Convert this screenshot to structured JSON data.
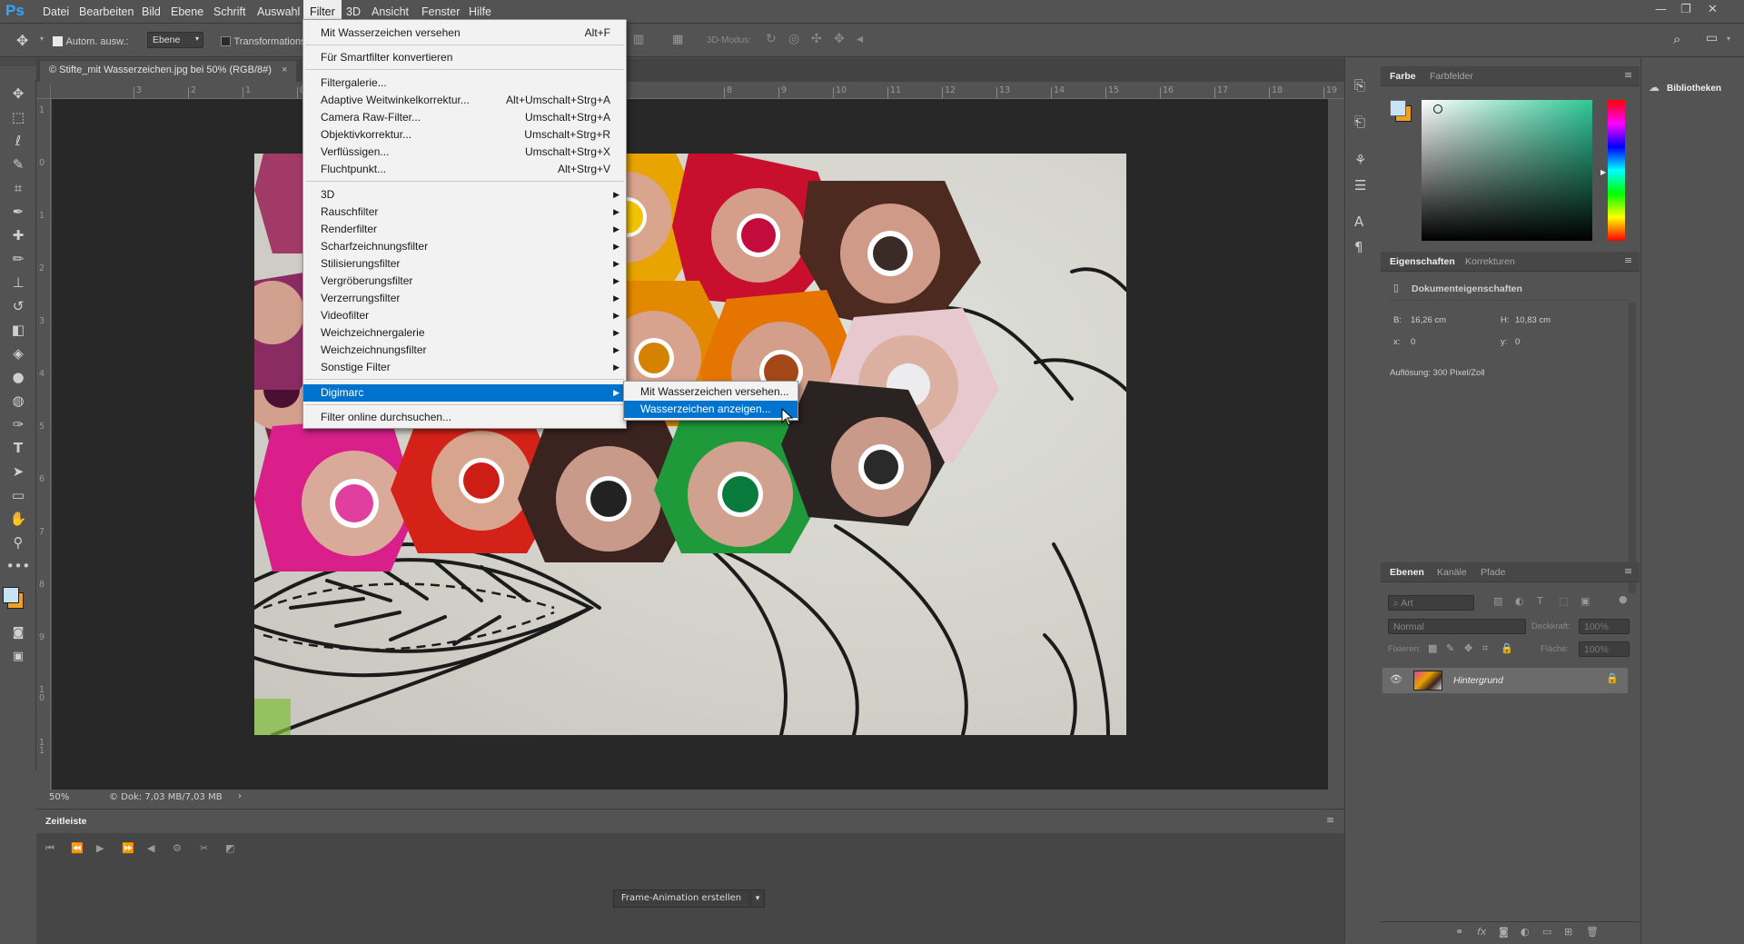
{
  "app": {
    "logo": "Ps"
  },
  "menubar": {
    "items": [
      "Datei",
      "Bearbeiten",
      "Bild",
      "Ebene",
      "Schrift",
      "Auswahl",
      "Filter",
      "3D",
      "Ansicht",
      "Fenster",
      "Hilfe"
    ],
    "active": "Filter"
  },
  "window_controls": {
    "minimize": "—",
    "restore": "❐",
    "close": "✕"
  },
  "options": {
    "auto_select_label": "Autom. ausw.:",
    "auto_select_value": "Ebene",
    "transform_label": "Transformationss",
    "mode_3d_label": "3D-Modus:"
  },
  "document": {
    "tab_title": "© Stifte_mit Wasserzeichen.jpg bei 50% (RGB/8#)",
    "tab_close": "×",
    "zoom": "50%",
    "doc_info": "© Dok: 7,03 MB/7,03 MB",
    "status_arrow": "›"
  },
  "ruler_h": [
    "3",
    "2",
    "1",
    "0",
    "8",
    "9",
    "10",
    "11",
    "12",
    "13",
    "14",
    "15",
    "16",
    "17",
    "18",
    "19"
  ],
  "ruler_v": [
    "1",
    "0",
    "1",
    "2",
    "3",
    "4",
    "5",
    "6",
    "7",
    "8",
    "9",
    "1 0",
    "1 1"
  ],
  "filter_menu": {
    "items": [
      {
        "label": "Mit Wasserzeichen versehen",
        "shortcut": "Alt+F"
      },
      {
        "label": "Für Smartfilter konvertieren",
        "shortcut": ""
      },
      {
        "label": "Filtergalerie...",
        "shortcut": ""
      },
      {
        "label": "Adaptive Weitwinkelkorrektur...",
        "shortcut": "Alt+Umschalt+Strg+A"
      },
      {
        "label": "Camera Raw-Filter...",
        "shortcut": "Umschalt+Strg+A"
      },
      {
        "label": "Objektivkorrektur...",
        "shortcut": "Umschalt+Strg+R"
      },
      {
        "label": "Verflüssigen...",
        "shortcut": "Umschalt+Strg+X"
      },
      {
        "label": "Fluchtpunkt...",
        "shortcut": "Alt+Strg+V"
      },
      {
        "label": "3D",
        "shortcut": ""
      },
      {
        "label": "Rauschfilter",
        "shortcut": ""
      },
      {
        "label": "Renderfilter",
        "shortcut": ""
      },
      {
        "label": "Scharfzeichnungsfilter",
        "shortcut": ""
      },
      {
        "label": "Stilisierungsfilter",
        "shortcut": ""
      },
      {
        "label": "Vergröberungsfilter",
        "shortcut": ""
      },
      {
        "label": "Verzerrungsfilter",
        "shortcut": ""
      },
      {
        "label": "Videofilter",
        "shortcut": ""
      },
      {
        "label": "Weichzeichnergalerie",
        "shortcut": ""
      },
      {
        "label": "Weichzeichnungsfilter",
        "shortcut": ""
      },
      {
        "label": "Sonstige Filter",
        "shortcut": ""
      },
      {
        "label": "Digimarc",
        "shortcut": ""
      },
      {
        "label": "Filter online durchsuchen...",
        "shortcut": ""
      }
    ],
    "submenu_arrow": "▶"
  },
  "digimarc_submenu": {
    "items": [
      "Mit Wasserzeichen versehen...",
      "Wasserzeichen anzeigen..."
    ],
    "highlighted": "Wasserzeichen anzeigen..."
  },
  "color_panel": {
    "tabs": [
      "Farbe",
      "Farbfelder"
    ],
    "hue": "#2fc896"
  },
  "properties_panel": {
    "tabs": [
      "Eigenschaften",
      "Korrekturen"
    ],
    "title": "Dokumenteigenschaften",
    "b_label": "B:",
    "b_value": "16,26 cm",
    "h_label": "H:",
    "h_value": "10,83 cm",
    "x_label": "x:",
    "x_value": "0",
    "y_label": "y:",
    "y_value": "0",
    "resolution": "Auflösung: 300 Pixel/Zoll"
  },
  "layers_panel": {
    "tabs": [
      "Ebenen",
      "Kanäle",
      "Pfade"
    ],
    "filter_placeholder": "Art",
    "blend_mode": "Normal",
    "opacity_label": "Deckkraft:",
    "opacity_value": "100%",
    "lock_label": "Fixieren:",
    "fill_label": "Fläche:",
    "fill_value": "100%",
    "layers": [
      {
        "name": "Hintergrund",
        "visible": true,
        "locked": true
      }
    ]
  },
  "libraries": {
    "label": "Bibliotheken"
  },
  "timeline": {
    "title": "Zeitleiste",
    "create_button": "Frame-Animation erstellen",
    "dropdown_arrow": "▾"
  },
  "colors": {
    "accent": "#0073cf",
    "foreground": "#c8e4f4",
    "background": "#f0a020"
  }
}
